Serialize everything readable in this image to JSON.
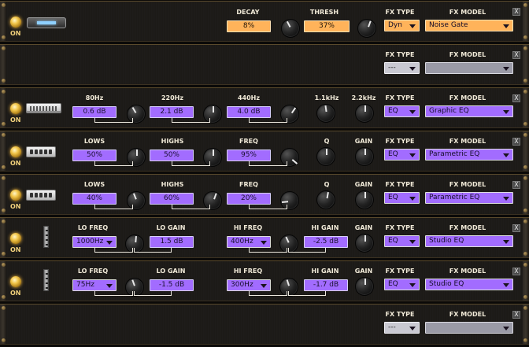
{
  "status_on": "ON",
  "close_label": "X",
  "fx_type_label": "FX TYPE",
  "fx_model_label": "FX MODEL",
  "rows": [
    {
      "slot": "Noise Gate",
      "fx_type": "Dyn",
      "fx_model": "Noise Gate",
      "params": [
        {
          "name": "DECAY",
          "value": "8%"
        },
        {
          "name": "THRESH",
          "value": "37%"
        }
      ]
    },
    {
      "slot": "Empty",
      "fx_type": "---",
      "fx_model": ""
    },
    {
      "slot": "Graphic EQ",
      "fx_type": "EQ",
      "fx_model": "Graphic EQ",
      "params": [
        {
          "name": "80Hz",
          "value": "0.6 dB"
        },
        {
          "name": "220Hz",
          "value": "2.1 dB"
        },
        {
          "name": "440Hz",
          "value": "4.0 dB"
        },
        {
          "name": "1.1kHz",
          "value": ""
        },
        {
          "name": "2.2kHz",
          "value": ""
        }
      ]
    },
    {
      "slot": "Parametric EQ",
      "fx_type": "EQ",
      "fx_model": "Parametric EQ",
      "params": [
        {
          "name": "LOWS",
          "value": "50%"
        },
        {
          "name": "HIGHS",
          "value": "50%"
        },
        {
          "name": "FREQ",
          "value": "95%"
        },
        {
          "name": "Q",
          "value": ""
        },
        {
          "name": "GAIN",
          "value": ""
        }
      ]
    },
    {
      "slot": "Parametric EQ",
      "fx_type": "EQ",
      "fx_model": "Parametric EQ",
      "params": [
        {
          "name": "LOWS",
          "value": "40%"
        },
        {
          "name": "HIGHS",
          "value": "60%"
        },
        {
          "name": "FREQ",
          "value": "20%"
        },
        {
          "name": "Q",
          "value": ""
        },
        {
          "name": "GAIN",
          "value": ""
        }
      ]
    },
    {
      "slot": "Studio EQ",
      "fx_type": "EQ",
      "fx_model": "Studio EQ",
      "params": [
        {
          "name": "LO FREQ",
          "value": "1000Hz"
        },
        {
          "name": "LO GAIN",
          "value": "1.5 dB"
        },
        {
          "name": "HI FREQ",
          "value": "400Hz"
        },
        {
          "name": "HI GAIN",
          "value": "-2.5 dB"
        },
        {
          "name": "GAIN",
          "value": ""
        }
      ]
    },
    {
      "slot": "Studio EQ",
      "fx_type": "EQ",
      "fx_model": "Studio EQ",
      "params": [
        {
          "name": "LO FREQ",
          "value": "75Hz"
        },
        {
          "name": "LO GAIN",
          "value": "-1.5 dB"
        },
        {
          "name": "HI FREQ",
          "value": "300Hz"
        },
        {
          "name": "HI GAIN",
          "value": "-1.7 dB"
        },
        {
          "name": "GAIN",
          "value": ""
        }
      ]
    },
    {
      "slot": "Empty",
      "fx_type": "---",
      "fx_model": ""
    }
  ]
}
